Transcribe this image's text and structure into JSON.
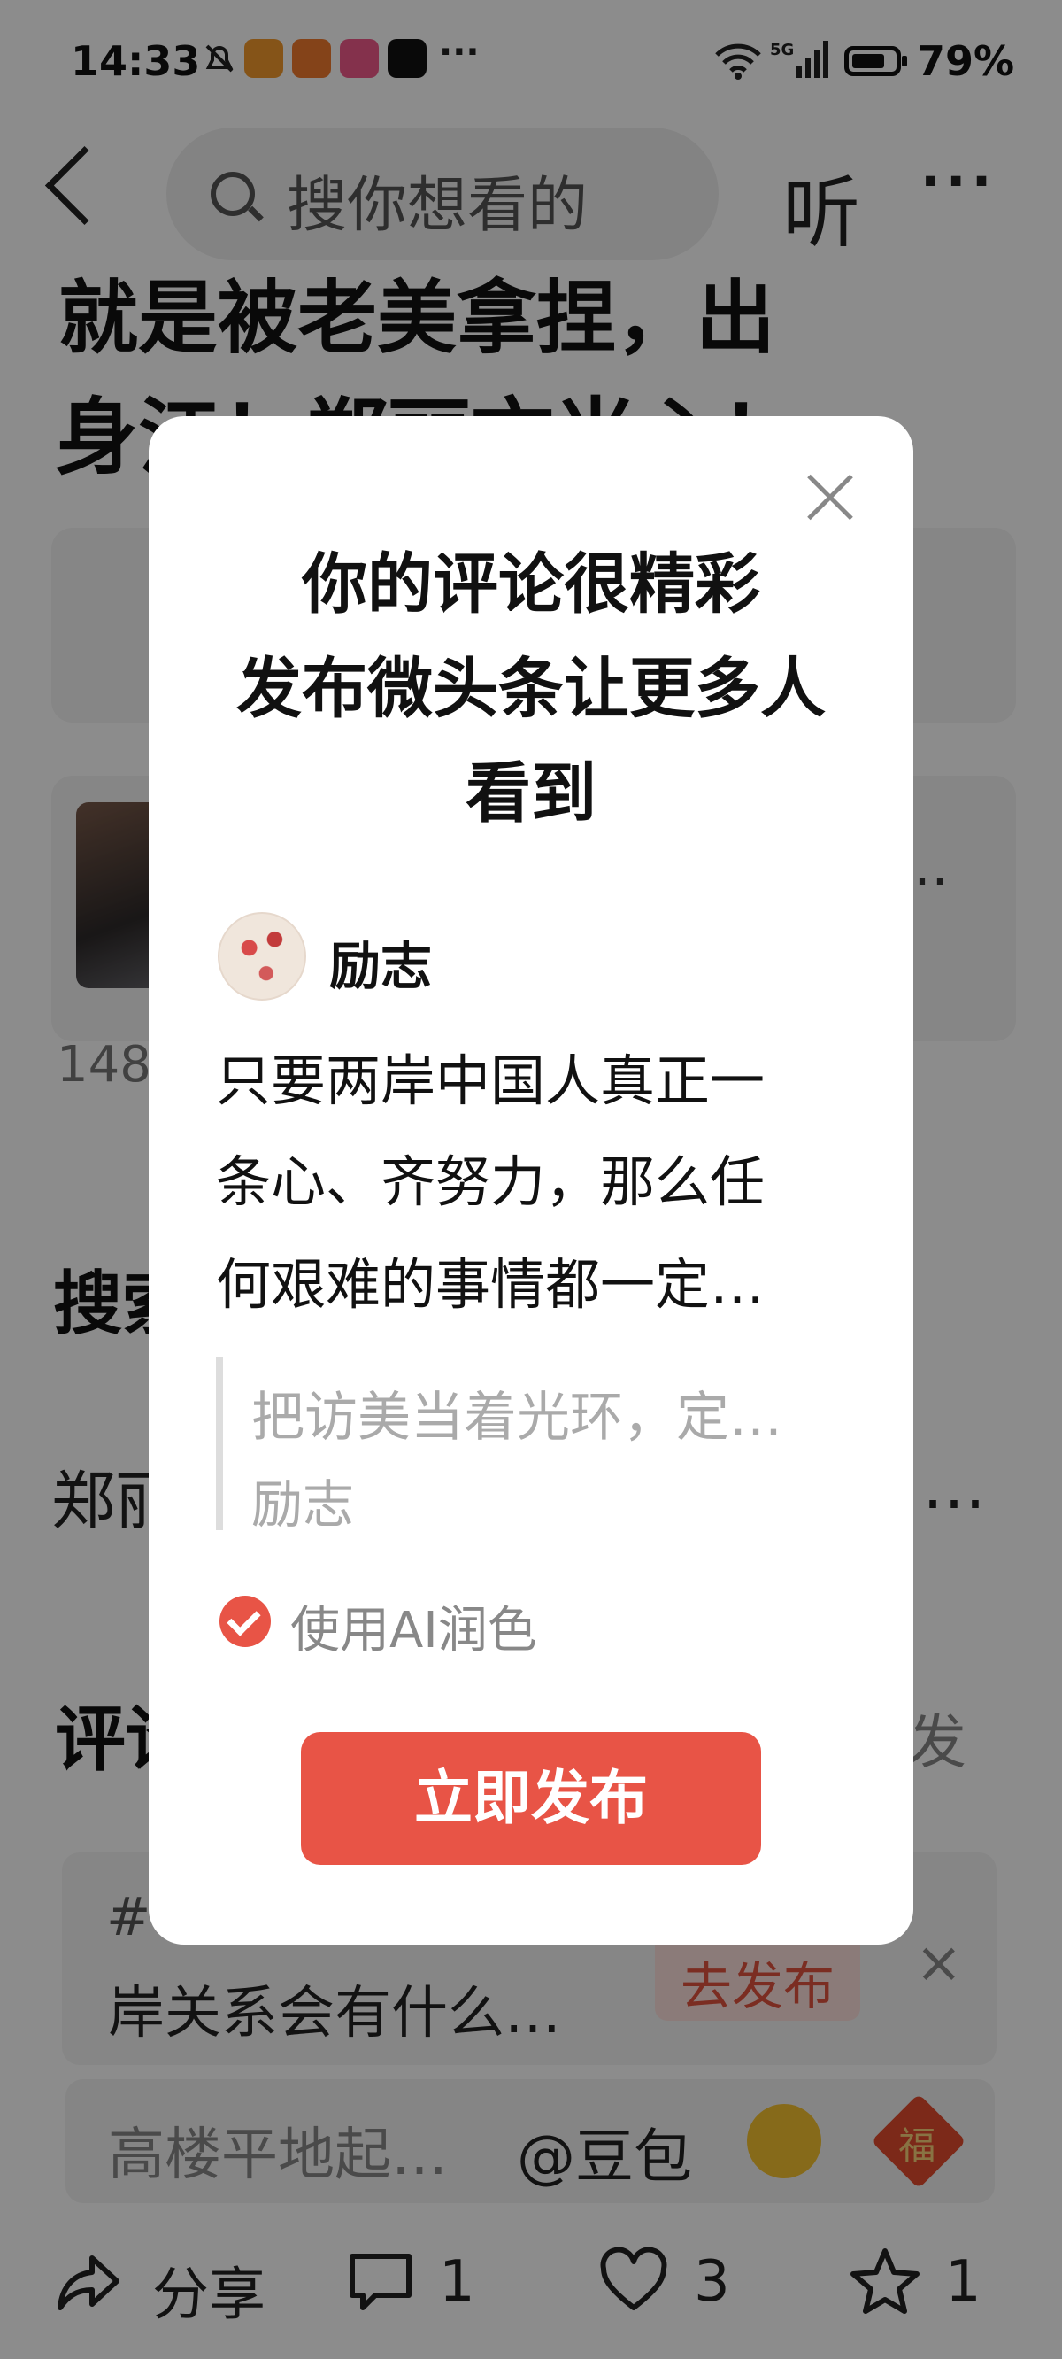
{
  "status_bar": {
    "time": "14:33",
    "battery_percent": "79%",
    "more": "···"
  },
  "nav": {
    "search_placeholder": "搜你想看的",
    "listen_label": "听",
    "more": "···"
  },
  "article": {
    "title_line1": "就是被老美拿捏，出",
    "title_line2": "身江！郑丽文当心！",
    "view_count": "148",
    "card_more": "…",
    "search_section_partial": "搜索",
    "related_left": "郑丽",
    "related_right": "…",
    "comments_partial": "评论",
    "publish_partial": "发"
  },
  "comment_prompt": {
    "hash": "#",
    "topic_text": "岸关系会有什么…",
    "publish_button": "去发布",
    "close": "×"
  },
  "comment_input": {
    "placeholder": "高楼平地起…",
    "mention": "@豆包",
    "fu": "福"
  },
  "bottom_bar": {
    "share_label": "分享",
    "comment_count": "1",
    "like_count": "3",
    "favorite_count": "1"
  },
  "modal": {
    "title_lines": [
      "你的评论很精彩",
      "发布微头条让更多人",
      "看到"
    ],
    "username": "励志",
    "comment_lines": [
      "只要两岸中国人真正一",
      "条心、齐努力，那么任",
      "何艰难的事情都一定…"
    ],
    "quote_text": "把访美当着光环，定…",
    "quote_author": "励志",
    "ai_polish_label": "使用AI润色",
    "ai_polish_checked": true,
    "publish_button": "立即发布"
  },
  "colors": {
    "accent": "#e85446",
    "overlay": "rgba(0,0,0,0.45)"
  }
}
